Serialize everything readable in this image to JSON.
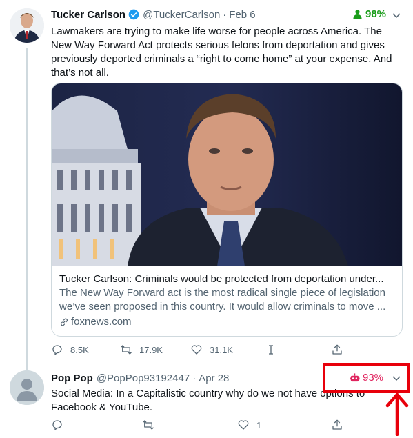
{
  "tweet1": {
    "name": "Tucker Carlson",
    "handle": "@TuckerCarlson",
    "separator": "·",
    "date": "Feb 6",
    "score": "98%",
    "score_color": "#1a9c1a",
    "text": "Lawmakers are trying to make life worse for people across America.  The New Way Forward Act protects serious felons from deportation and gives previously deported criminals a “right to come home” at your expense.  And that’s not all.",
    "card": {
      "title": "Tucker Carlson: Criminals would be protected from deportation under...",
      "description": "The New Way Forward act is the most radical single piece of legislation we’ve seen proposed in this country. It would allow criminals to move ...",
      "domain": "foxnews.com"
    },
    "actions": {
      "replies": "8.5K",
      "retweets": "17.9K",
      "likes": "31.1K"
    }
  },
  "tweet2": {
    "name": "Pop Pop",
    "handle": "@PopPop93192447",
    "separator": "·",
    "date": "Apr 28",
    "score": "93%",
    "score_color": "#e0245e",
    "text": "Social Media:  In  a Capitalistic country why do we not have options to Facebook & YouTube.",
    "actions": {
      "likes": "1"
    }
  },
  "colors": {
    "link_blue": "#1d9bf0",
    "secondary_gray": "#536471",
    "annotation_red": "#e8000b"
  },
  "icons": {
    "verified": "verified-badge-icon",
    "human_score": "person-icon",
    "bot_score": "robot-icon",
    "reply": "reply-icon",
    "retweet": "retweet-icon",
    "like": "heart-icon",
    "share": "share-icon",
    "link": "link-icon",
    "more": "chevron-down-icon"
  }
}
